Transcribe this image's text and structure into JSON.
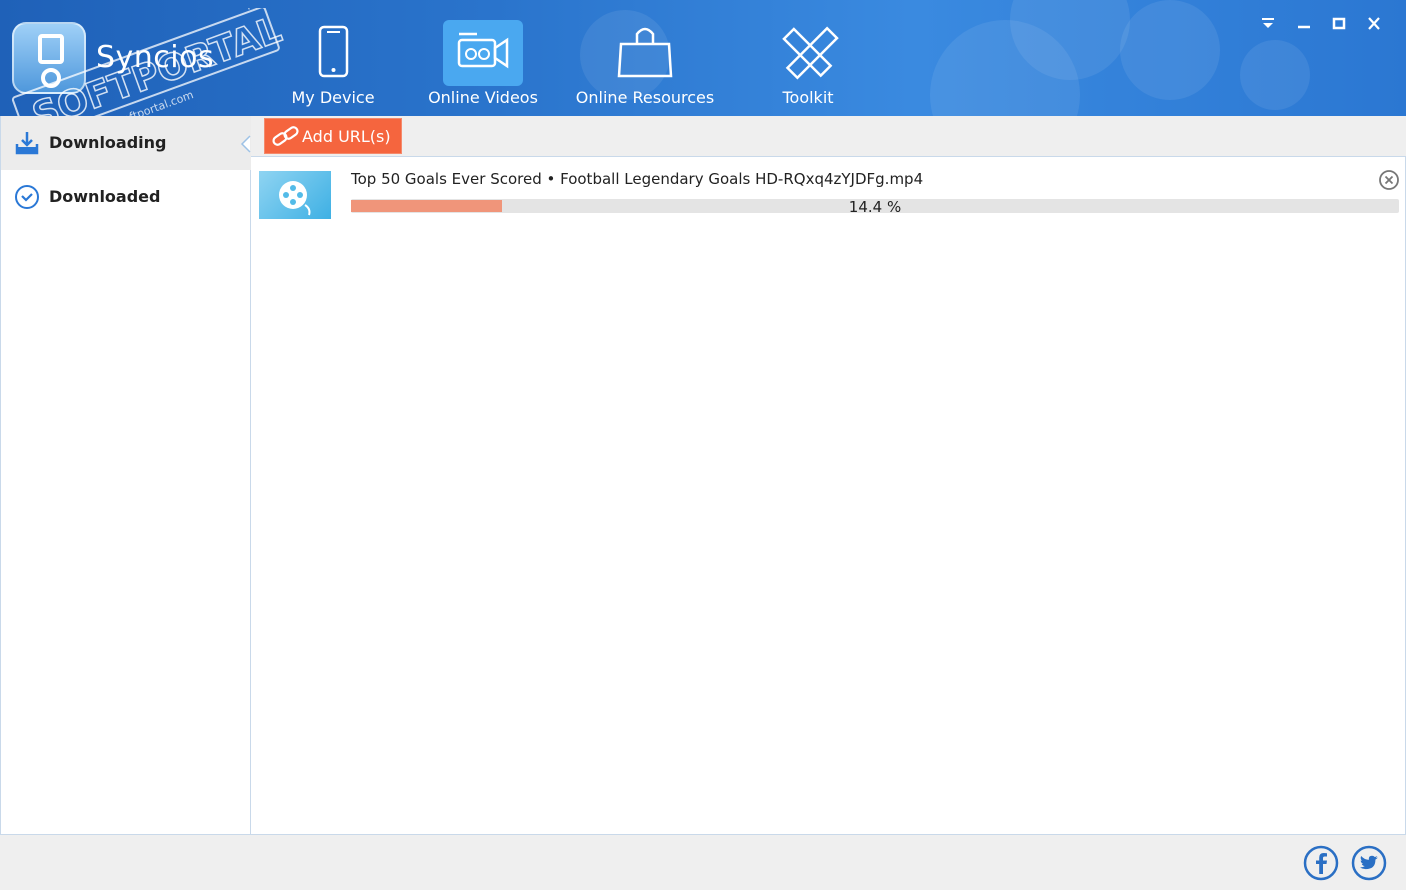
{
  "app": {
    "name": "Syncios",
    "watermark_text": "SOFTPORTAL",
    "watermark_url": "www.softportal.com",
    "watermark_tm": "TM"
  },
  "nav": {
    "items": [
      {
        "label": "My Device",
        "icon": "phone-icon",
        "active": false
      },
      {
        "label": "Online Videos",
        "icon": "video-camera-icon",
        "active": true
      },
      {
        "label": "Online Resources",
        "icon": "shopping-bag-icon",
        "active": false
      },
      {
        "label": "Toolkit",
        "icon": "toolkit-icon",
        "active": false
      }
    ]
  },
  "window_controls": {
    "menu": "menu-icon",
    "minimize": "minimize-icon",
    "maximize": "maximize-icon",
    "close": "close-icon"
  },
  "sidebar": {
    "items": [
      {
        "label": "Downloading",
        "icon": "download-tray-icon",
        "active": true
      },
      {
        "label": "Downloaded",
        "icon": "check-circle-icon",
        "active": false
      }
    ]
  },
  "toolbar": {
    "add_url_label": "Add URL(s)"
  },
  "downloads": [
    {
      "file_name": "Top 50 Goals Ever Scored • Football Legendary Goals HD-RQxq4zYJDFg.mp4",
      "progress": 0.144,
      "progress_text": "14.4 %"
    }
  ],
  "colors": {
    "header": "#2a74cc",
    "active_nav": "#4aa8f0",
    "accent_button": "#f5653e",
    "progress_fill": "#f0957a"
  },
  "footer": {
    "social": [
      "facebook-icon",
      "twitter-icon"
    ]
  }
}
